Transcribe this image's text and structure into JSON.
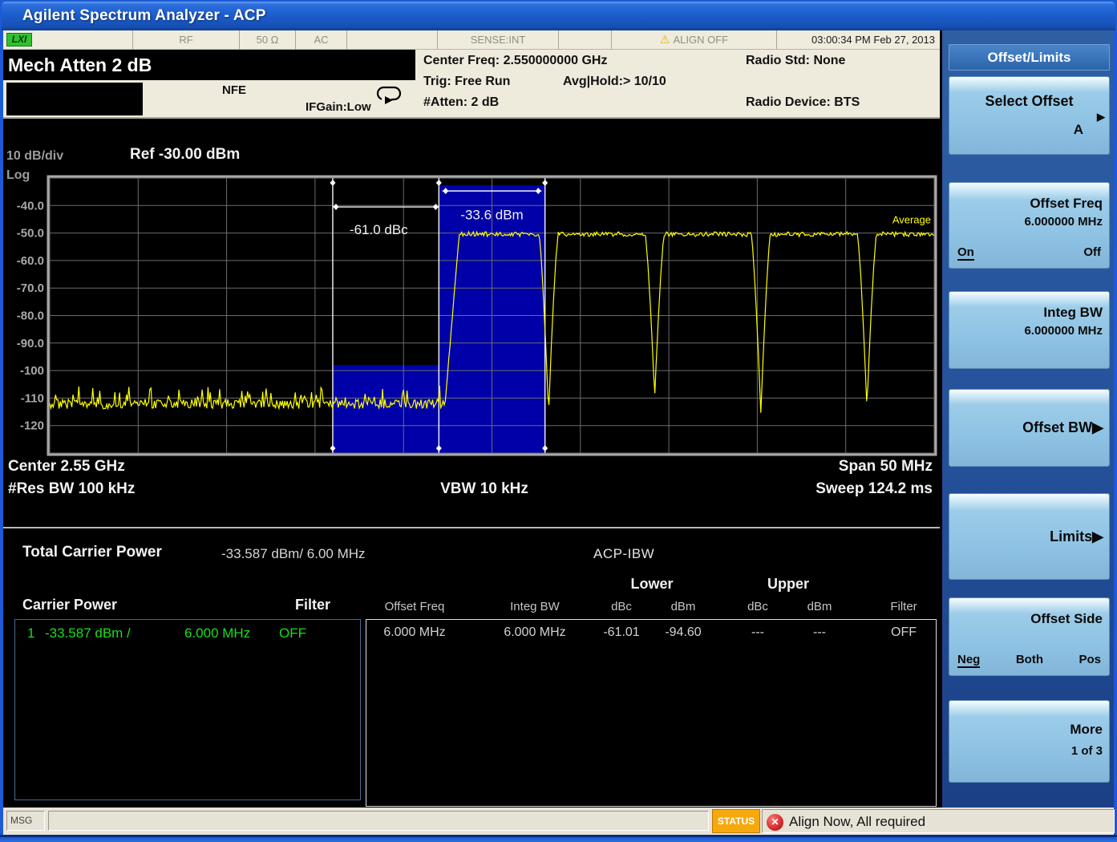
{
  "window": {
    "title": "Agilent Spectrum Analyzer - ACP"
  },
  "icons": {
    "warning": "⚠",
    "error_x": "✕",
    "arrow": "▶"
  },
  "status_strip": {
    "lxi": "LXI",
    "rf": "RF",
    "impedance": "50 Ω",
    "coupling": "AC",
    "sense": "SENSE:INT",
    "align_warning": "ALIGN OFF",
    "datetime": "03:00:34 PM Feb 27, 2013"
  },
  "annunciators": {
    "mech_atten": "Mech Atten 2 dB",
    "nfe": "NFE",
    "ifgain": "IFGain:Low"
  },
  "meas_info": {
    "center_freq": "Center Freq: 2.550000000 GHz",
    "radio_std": "Radio Std: None",
    "trig": "Trig: Free Run",
    "avg_hold": "Avg|Hold:> 10/10",
    "atten": "#Atten: 2 dB",
    "radio_device": "Radio Device: BTS"
  },
  "chart_header": {
    "scale": "10 dB/div",
    "ref": "Ref -30.00 dBm",
    "log": "Log"
  },
  "chart_footer": {
    "center": "Center  2.55 GHz",
    "res_bw": "#Res BW  100 kHz",
    "vbw": "VBW  10 kHz",
    "span": "Span 50 MHz",
    "sweep": "Sweep  124.2 ms"
  },
  "chart_data": {
    "type": "line",
    "title": "ACP spectrum measurement trace",
    "trace_name": "Average",
    "x_unit": "MHz",
    "x_range": [
      2525,
      2575
    ],
    "y_unit": "dBm",
    "y_range": [
      -130,
      -30
    ],
    "ref_level_dbm": -30,
    "scale_db_per_div": 10,
    "grid_divs": 10,
    "y_ticks": [
      {
        "label": "-40.0",
        "value": -40
      },
      {
        "label": "-50.0",
        "value": -50
      },
      {
        "label": "-60.0",
        "value": -60
      },
      {
        "label": "-70.0",
        "value": -70
      },
      {
        "label": "-80.0",
        "value": -80
      },
      {
        "label": "-90.0",
        "value": -90
      },
      {
        "label": "-100",
        "value": -100
      },
      {
        "label": "-110",
        "value": -110
      },
      {
        "label": "-120",
        "value": -120
      }
    ],
    "noise_floor_dbm": -112,
    "carrier_plateau_dbm": -50.4,
    "carrier_rise_mhz": [
      2547.35,
      2548.15
    ],
    "notches_mhz": [
      2553.2,
      2559.2,
      2565.2,
      2571.2
    ],
    "notch_depths_dbm": [
      -116,
      -110,
      -116,
      -114
    ],
    "notch_half_width_mhz": 0.55,
    "carrier_band_mhz": [
      2547,
      2553
    ],
    "carrier_band_top_dbm": -32.6,
    "offset_band_mhz": [
      2541,
      2547
    ],
    "offset_band_top_dbm": -98,
    "markers_mhz": [
      2541,
      2547,
      2553
    ],
    "annotations": [
      {
        "text": "-61.0 dBc",
        "from_mhz": 2541,
        "to_mhz": 2547,
        "line_y_dbm": -40.5,
        "text_x_mhz": 2543.6,
        "text_y_dbm": -48.6
      },
      {
        "text": "-33.6 dBm",
        "from_mhz": 2547.2,
        "to_mhz": 2552.8,
        "line_y_dbm": -34.7,
        "text_x_mhz": 2550,
        "text_y_dbm": -43.2
      }
    ]
  },
  "results": {
    "total_label": "Total Carrier Power",
    "total_value": "-33.587 dBm/ 6.00 MHz",
    "mode_label": "ACP-IBW",
    "carrier_table": {
      "header_left": "Carrier Power",
      "header_right": "Filter",
      "rows": [
        {
          "index": "1",
          "power": "-33.587 dBm /",
          "bw": "6.000 MHz",
          "filter": "OFF"
        }
      ]
    },
    "offset_table": {
      "group_headers": [
        "Lower",
        "Upper"
      ],
      "columns": [
        "Offset Freq",
        "Integ BW",
        "dBc",
        "dBm",
        "dBc",
        "dBm",
        "Filter"
      ],
      "rows": [
        [
          "6.000 MHz",
          "6.000 MHz",
          "-61.01",
          "-94.60",
          "---",
          "---",
          "OFF"
        ]
      ]
    }
  },
  "menu": {
    "title": "Offset/Limits",
    "buttons": [
      {
        "id": "select-offset",
        "title": "Select Offset",
        "value": "A",
        "arrow": true,
        "style": "select"
      },
      {
        "id": "offset-freq",
        "title": "Offset Freq",
        "value": "6.000000 MHz",
        "style": "value-toggle",
        "toggle": {
          "options": [
            "On",
            "Off"
          ],
          "selected": "On"
        }
      },
      {
        "id": "integ-bw",
        "title": "Integ BW",
        "value": "6.000000 MHz",
        "style": "value"
      },
      {
        "id": "offset-bw",
        "title": "Offset BW",
        "arrow": true,
        "style": "inline-arrow"
      },
      {
        "id": "limits",
        "title": "Limits",
        "arrow": true,
        "style": "inline-arrow"
      },
      {
        "id": "offset-side",
        "title": "Offset Side",
        "style": "toggle",
        "toggle": {
          "options": [
            "Neg",
            "Both",
            "Pos"
          ],
          "selected": "Neg"
        }
      },
      {
        "id": "more",
        "title": "More",
        "value": "1 of 3",
        "style": "value-center"
      }
    ]
  },
  "status_bar": {
    "msg_label": "MSG",
    "status_label": "STATUS",
    "message": "Align Now, All required"
  },
  "colors": {
    "trace": "#FFFF00",
    "band": "#0000A8",
    "grid": "#6C6C6C",
    "frame": "#A8A8A8",
    "green_value": "#18DF18",
    "status_badge": "#F6A80C",
    "menu_button": "#8FC3E4"
  }
}
